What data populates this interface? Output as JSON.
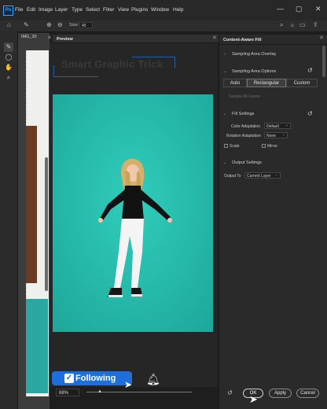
{
  "app": {
    "logo": "Ps"
  },
  "menu": [
    "File",
    "Edit",
    "Image",
    "Layer",
    "Type",
    "Select",
    "Filter",
    "View",
    "Plugins",
    "Window",
    "Help"
  ],
  "window_controls": [
    "—",
    "▢",
    "✕"
  ],
  "options_bar": {
    "size_label": "Size:",
    "size_value": "45"
  },
  "document_tab": {
    "name": "IMG_20"
  },
  "preview": {
    "tab_label": "Preview",
    "watermark": "Smart Graphic Trick",
    "zoom": "68%"
  },
  "overlay": {
    "following_label": "Following"
  },
  "panel": {
    "title": "Content-Aware Fill",
    "sampling_overlay": "Sampling Area Overlay",
    "sampling_options": "Sampling Area Options",
    "segments": [
      "Auto",
      "Rectangular",
      "Custom"
    ],
    "selected_segment": "Rectangular",
    "sample_all_layers": "Sample All Layers",
    "fill_settings": "Fill Settings",
    "color_adaptation_label": "Color Adaptation",
    "color_adaptation_value": "Default",
    "rotation_adaptation_label": "Rotation Adaptation",
    "rotation_adaptation_value": "None",
    "scale_label": "Scale",
    "mirror_label": "Mirror",
    "output_settings": "Output Settings",
    "output_to_label": "Output To",
    "output_to_value": "Current Layer",
    "buttons": {
      "ok": "OK",
      "apply": "Apply",
      "cancel": "Cancel"
    }
  },
  "colors": {
    "backdrop": "#25c0b0",
    "accent": "#1e6fd9",
    "ps_blue": "#31a8ff"
  },
  "icons": [
    "home-icon",
    "brush-icon",
    "add-brush-icon",
    "subtract-brush-icon",
    "search-icon",
    "lightbulb-icon",
    "workspace-icon",
    "share-icon",
    "lasso-icon",
    "zoom-icon",
    "hand-icon",
    "bell-icon",
    "check-icon",
    "reset-icon",
    "cursor-icon"
  ]
}
